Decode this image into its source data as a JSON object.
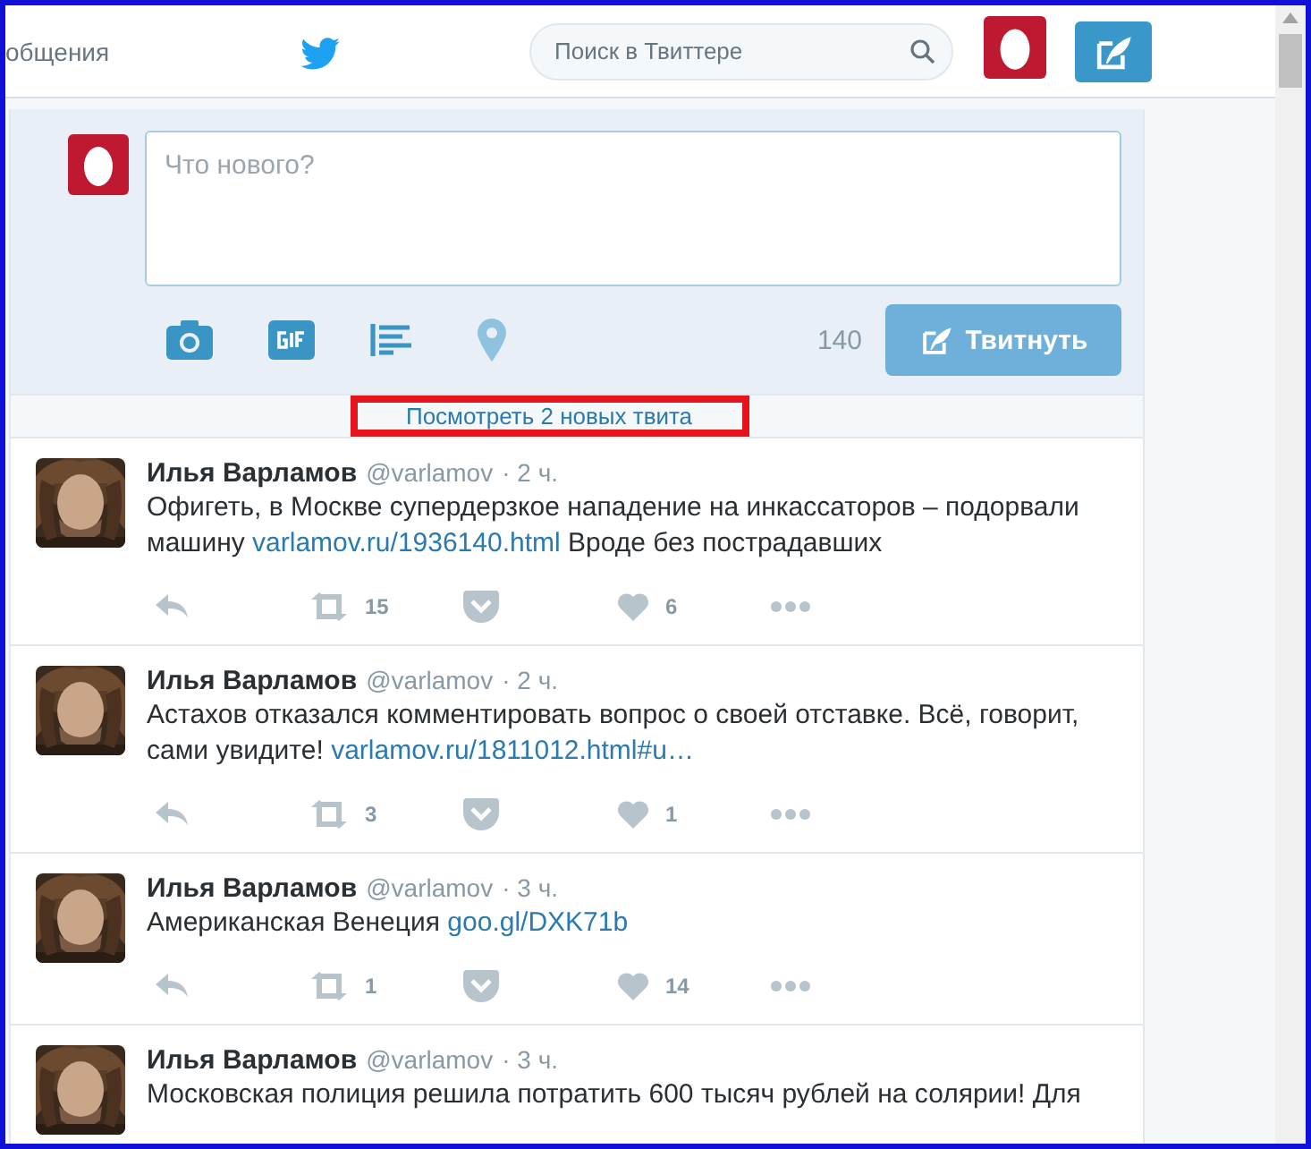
{
  "header": {
    "nav_label": "общения",
    "search": {
      "placeholder": "Поиск в Твиттере"
    }
  },
  "compose": {
    "placeholder": "Что нового?",
    "char_count": "140",
    "tweet_button": {
      "label": "Твитнуть",
      "disabled": true
    }
  },
  "new_tweets": {
    "label": "Посмотреть 2 новых твита",
    "highlighted": true
  },
  "tweets": [
    {
      "name": "Илья Варламов",
      "handle": "@varlamov",
      "time": "· 2 ч.",
      "text": [
        {
          "kind": "text",
          "text": "Офигеть, в Москве супердерзкое нападение на инкассаторов –  подорвали машину"
        },
        {
          "kind": "link",
          "text": "varlamov.ru/1936140.html"
        },
        {
          "kind": "text",
          "text": "Вроде без пострадавших"
        }
      ],
      "actions": {
        "retweets": "15",
        "likes": "6"
      }
    },
    {
      "name": "Илья Варламов",
      "handle": "@varlamov",
      "time": "· 2 ч.",
      "text": [
        {
          "kind": "text",
          "text": "Астахов отказался комментировать вопрос о своей отставке. Всё, говорит, сами увидите!"
        },
        {
          "kind": "link",
          "text": "varlamov.ru/1811012.html#u…"
        }
      ],
      "actions": {
        "retweets": "3",
        "likes": "1"
      }
    },
    {
      "name": "Илья Варламов",
      "handle": "@varlamov",
      "time": "· 3 ч.",
      "text": [
        {
          "kind": "text",
          "text": "Американская Венеция"
        },
        {
          "kind": "link",
          "text": "goo.gl/DXK71b"
        }
      ],
      "actions": {
        "retweets": "1",
        "likes": "14"
      }
    },
    {
      "name": "Илья Варламов",
      "handle": "@varlamov",
      "time": "· 3 ч.",
      "text": [
        {
          "kind": "text",
          "text": "Московская полиция решила потратить 600 тысяч рублей на солярии! Для"
        }
      ]
    }
  ]
}
